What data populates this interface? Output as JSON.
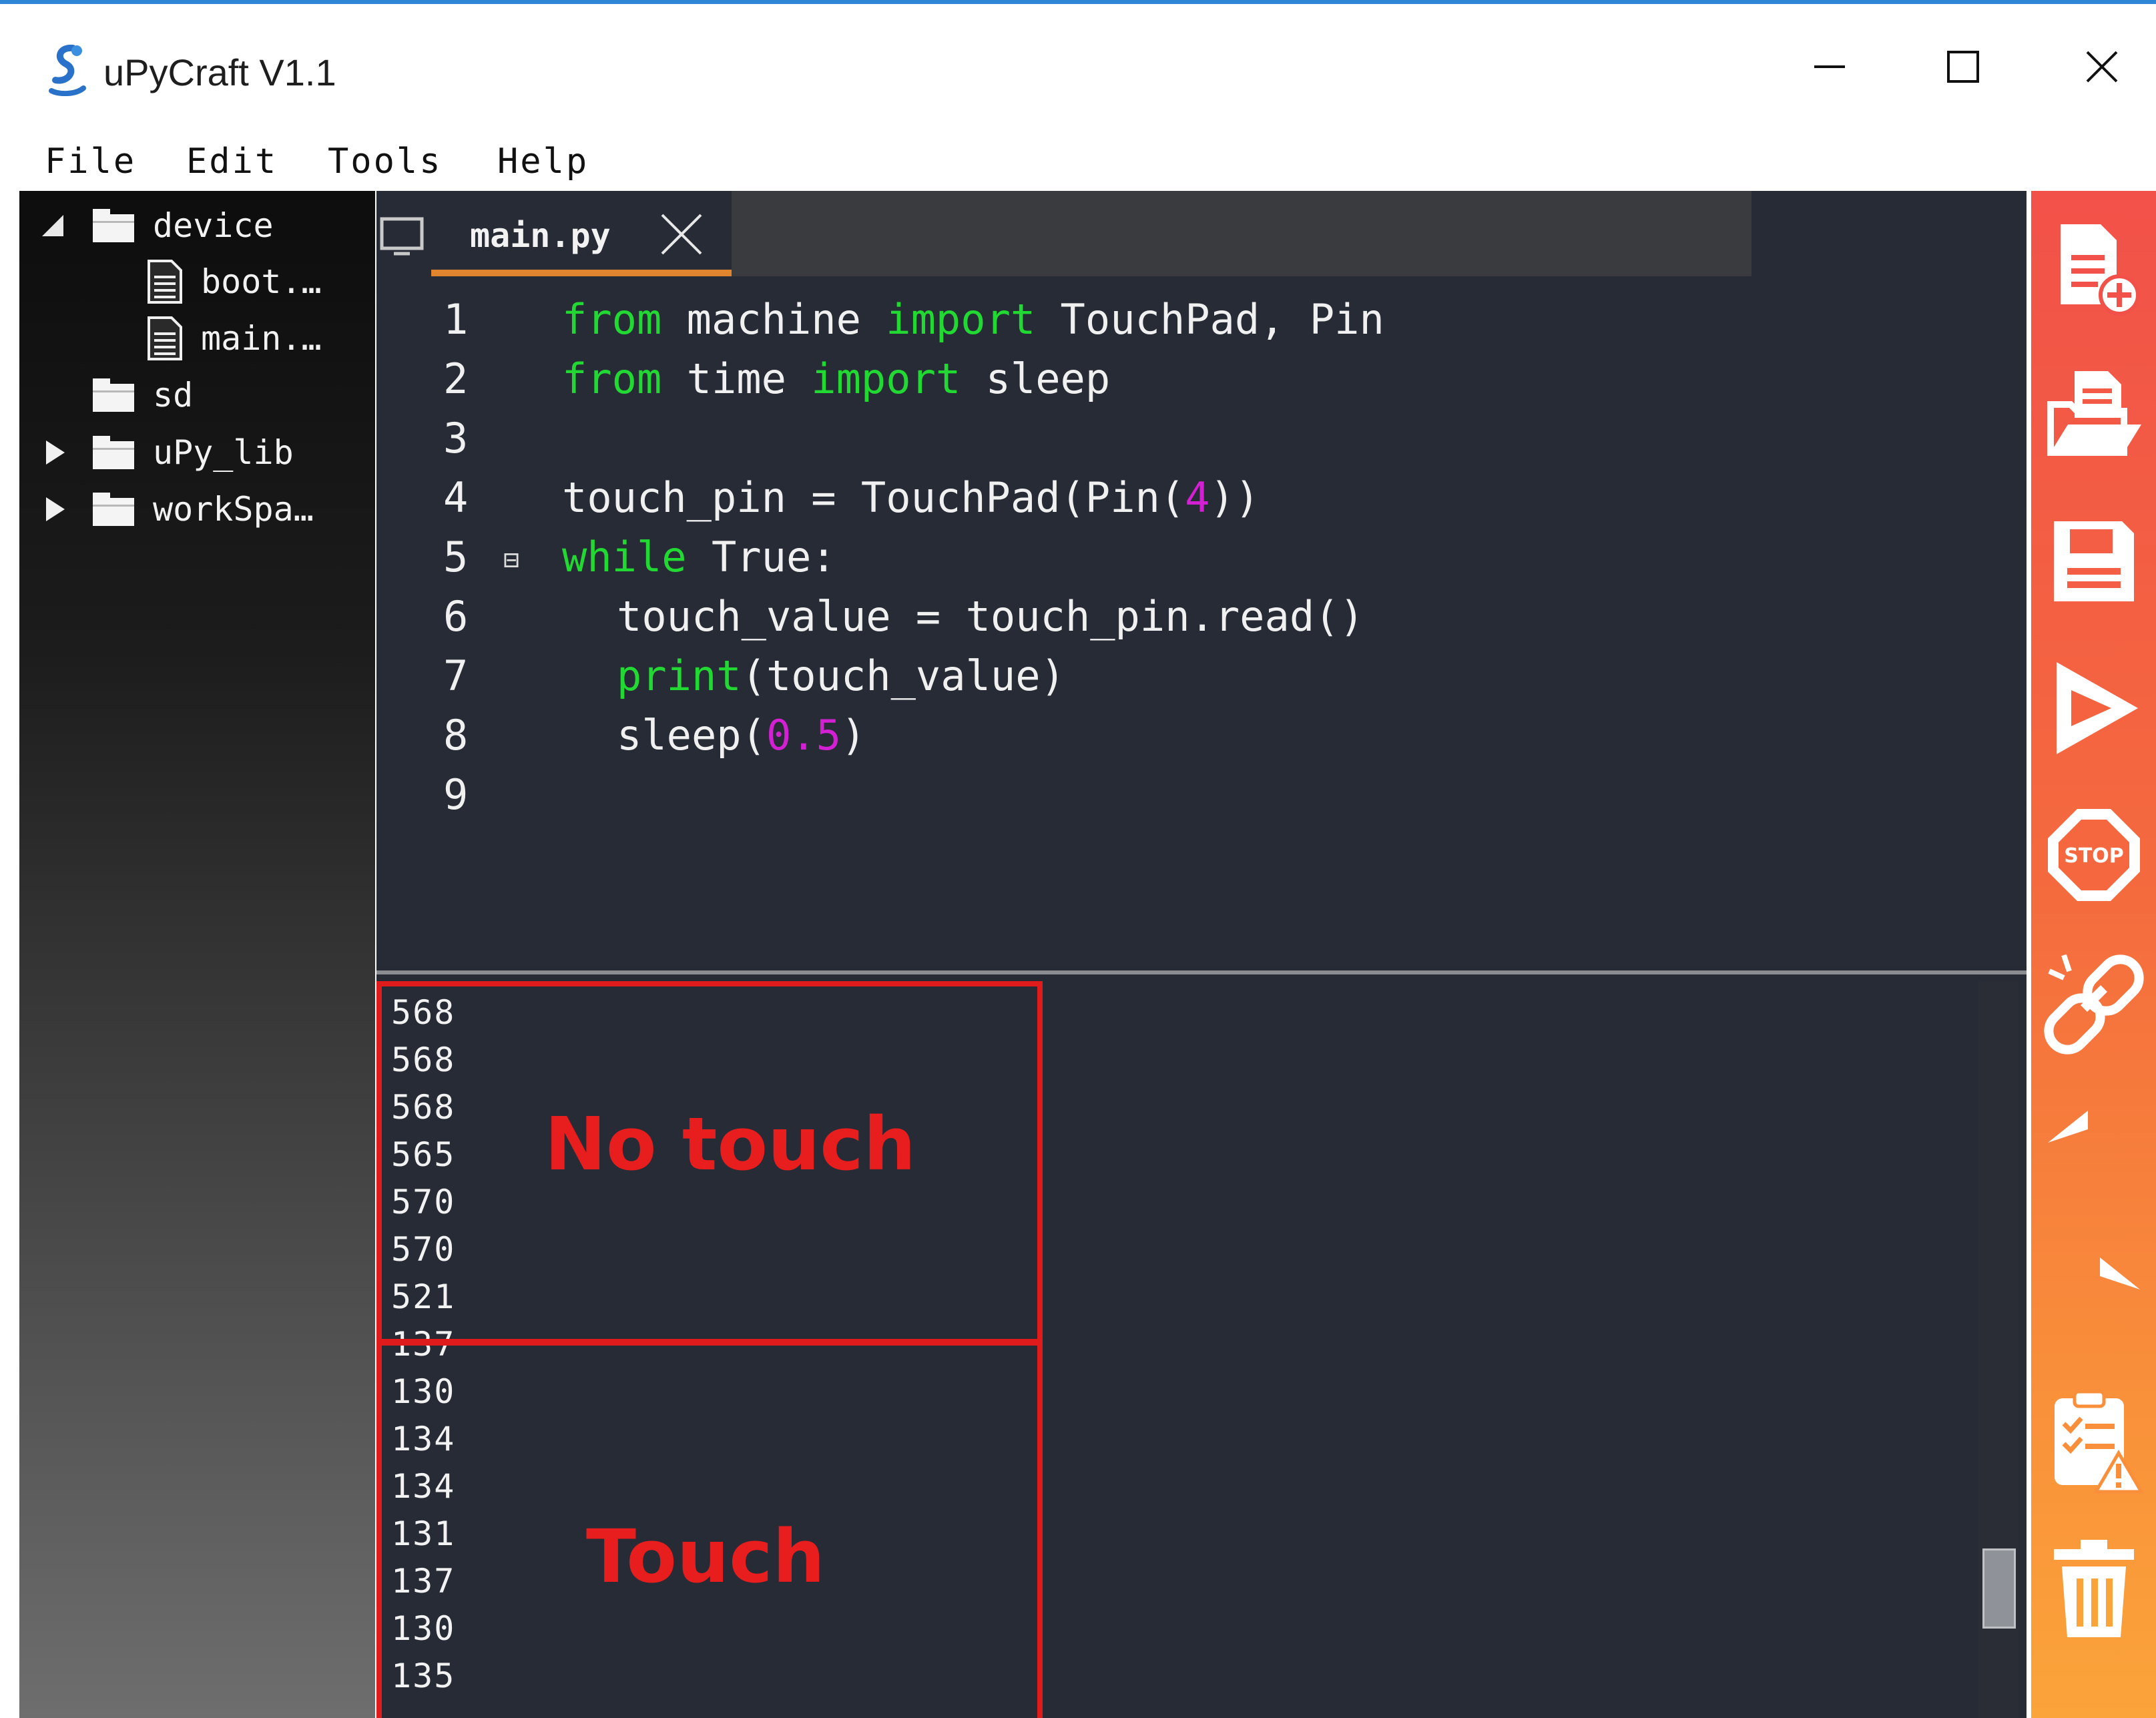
{
  "window": {
    "title": "uPyCraft V1.1"
  },
  "menu": [
    "File",
    "Edit",
    "Tools",
    "Help"
  ],
  "tree": {
    "device": "device",
    "boot": "boot.…",
    "main": "main.…",
    "sd": "sd",
    "upy_lib": "uPy_lib",
    "workspace": "workSpa…"
  },
  "editor": {
    "tab_label": "main.py",
    "lines": [
      {
        "n": "1",
        "parts": [
          [
            "kw",
            "from"
          ],
          [
            "t",
            " machine "
          ],
          [
            "kw",
            "import"
          ],
          [
            "t",
            " TouchPad, Pin"
          ]
        ]
      },
      {
        "n": "2",
        "parts": [
          [
            "kw",
            "from"
          ],
          [
            "t",
            " time "
          ],
          [
            "kw",
            "import"
          ],
          [
            "t",
            " sleep"
          ]
        ]
      },
      {
        "n": "3",
        "parts": []
      },
      {
        "n": "4",
        "parts": [
          [
            "t",
            "touch_pin = TouchPad(Pin("
          ],
          [
            "num",
            "4"
          ],
          [
            "t",
            "))"
          ]
        ]
      },
      {
        "n": "5",
        "fold": true,
        "parts": [
          [
            "kw",
            "while"
          ],
          [
            "t",
            " True:"
          ]
        ]
      },
      {
        "n": "6",
        "indent": true,
        "parts": [
          [
            "t",
            "touch_value = touch_pin.read()"
          ]
        ]
      },
      {
        "n": "7",
        "indent": true,
        "parts": [
          [
            "kw",
            "print"
          ],
          [
            "t",
            "(touch_value)"
          ]
        ]
      },
      {
        "n": "8",
        "indent": true,
        "parts": [
          [
            "t",
            "sleep("
          ],
          [
            "num",
            "0.5"
          ],
          [
            "t",
            ")"
          ]
        ]
      },
      {
        "n": "9",
        "parts": []
      }
    ]
  },
  "shell": {
    "values": [
      "568",
      "568",
      "568",
      "565",
      "570",
      "570",
      "521",
      "137",
      "130",
      "134",
      "134",
      "131",
      "137",
      "130",
      "135"
    ],
    "no_touch_label": "No touch",
    "touch_label": "Touch"
  },
  "colors": {
    "keyword": "#22d833",
    "number": "#d320d3",
    "annotation": "#e01b1b",
    "toolbar_top": "#f25149",
    "toolbar_bottom": "#fba43a"
  },
  "toolbar_icons": [
    "new-file-icon",
    "open-file-icon",
    "save-icon",
    "run-icon",
    "stop-icon",
    "connect-icon",
    "undo-icon",
    "redo-icon",
    "syntax-check-icon",
    "clear-icon"
  ]
}
